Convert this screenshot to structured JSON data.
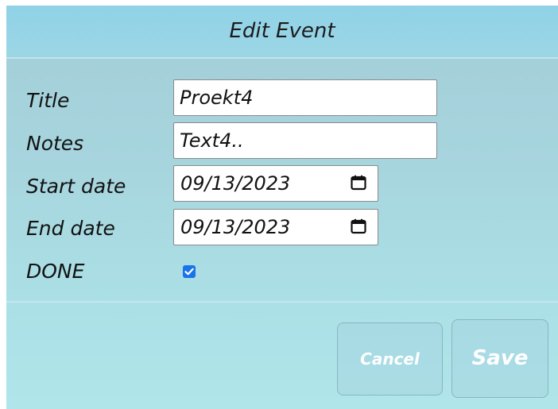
{
  "dialog": {
    "title": "Edit Event"
  },
  "form": {
    "title_label": "Title",
    "title_value": "Proekt4",
    "notes_label": "Notes",
    "notes_value": "Text4..",
    "start_date_label": "Start date",
    "start_date_value": "09/13/2023",
    "end_date_label": "End date",
    "end_date_value": "09/13/2023",
    "done_label": "DONE",
    "done_checked": true
  },
  "buttons": {
    "cancel_label": "Cancel",
    "save_label": "Save"
  },
  "colors": {
    "header": "#8fd2e6",
    "body": "#a7d5de",
    "checkbox": "#1a73e8"
  },
  "icons": {
    "date_picker": "calendar-icon",
    "checkbox": "checkmark-icon"
  }
}
